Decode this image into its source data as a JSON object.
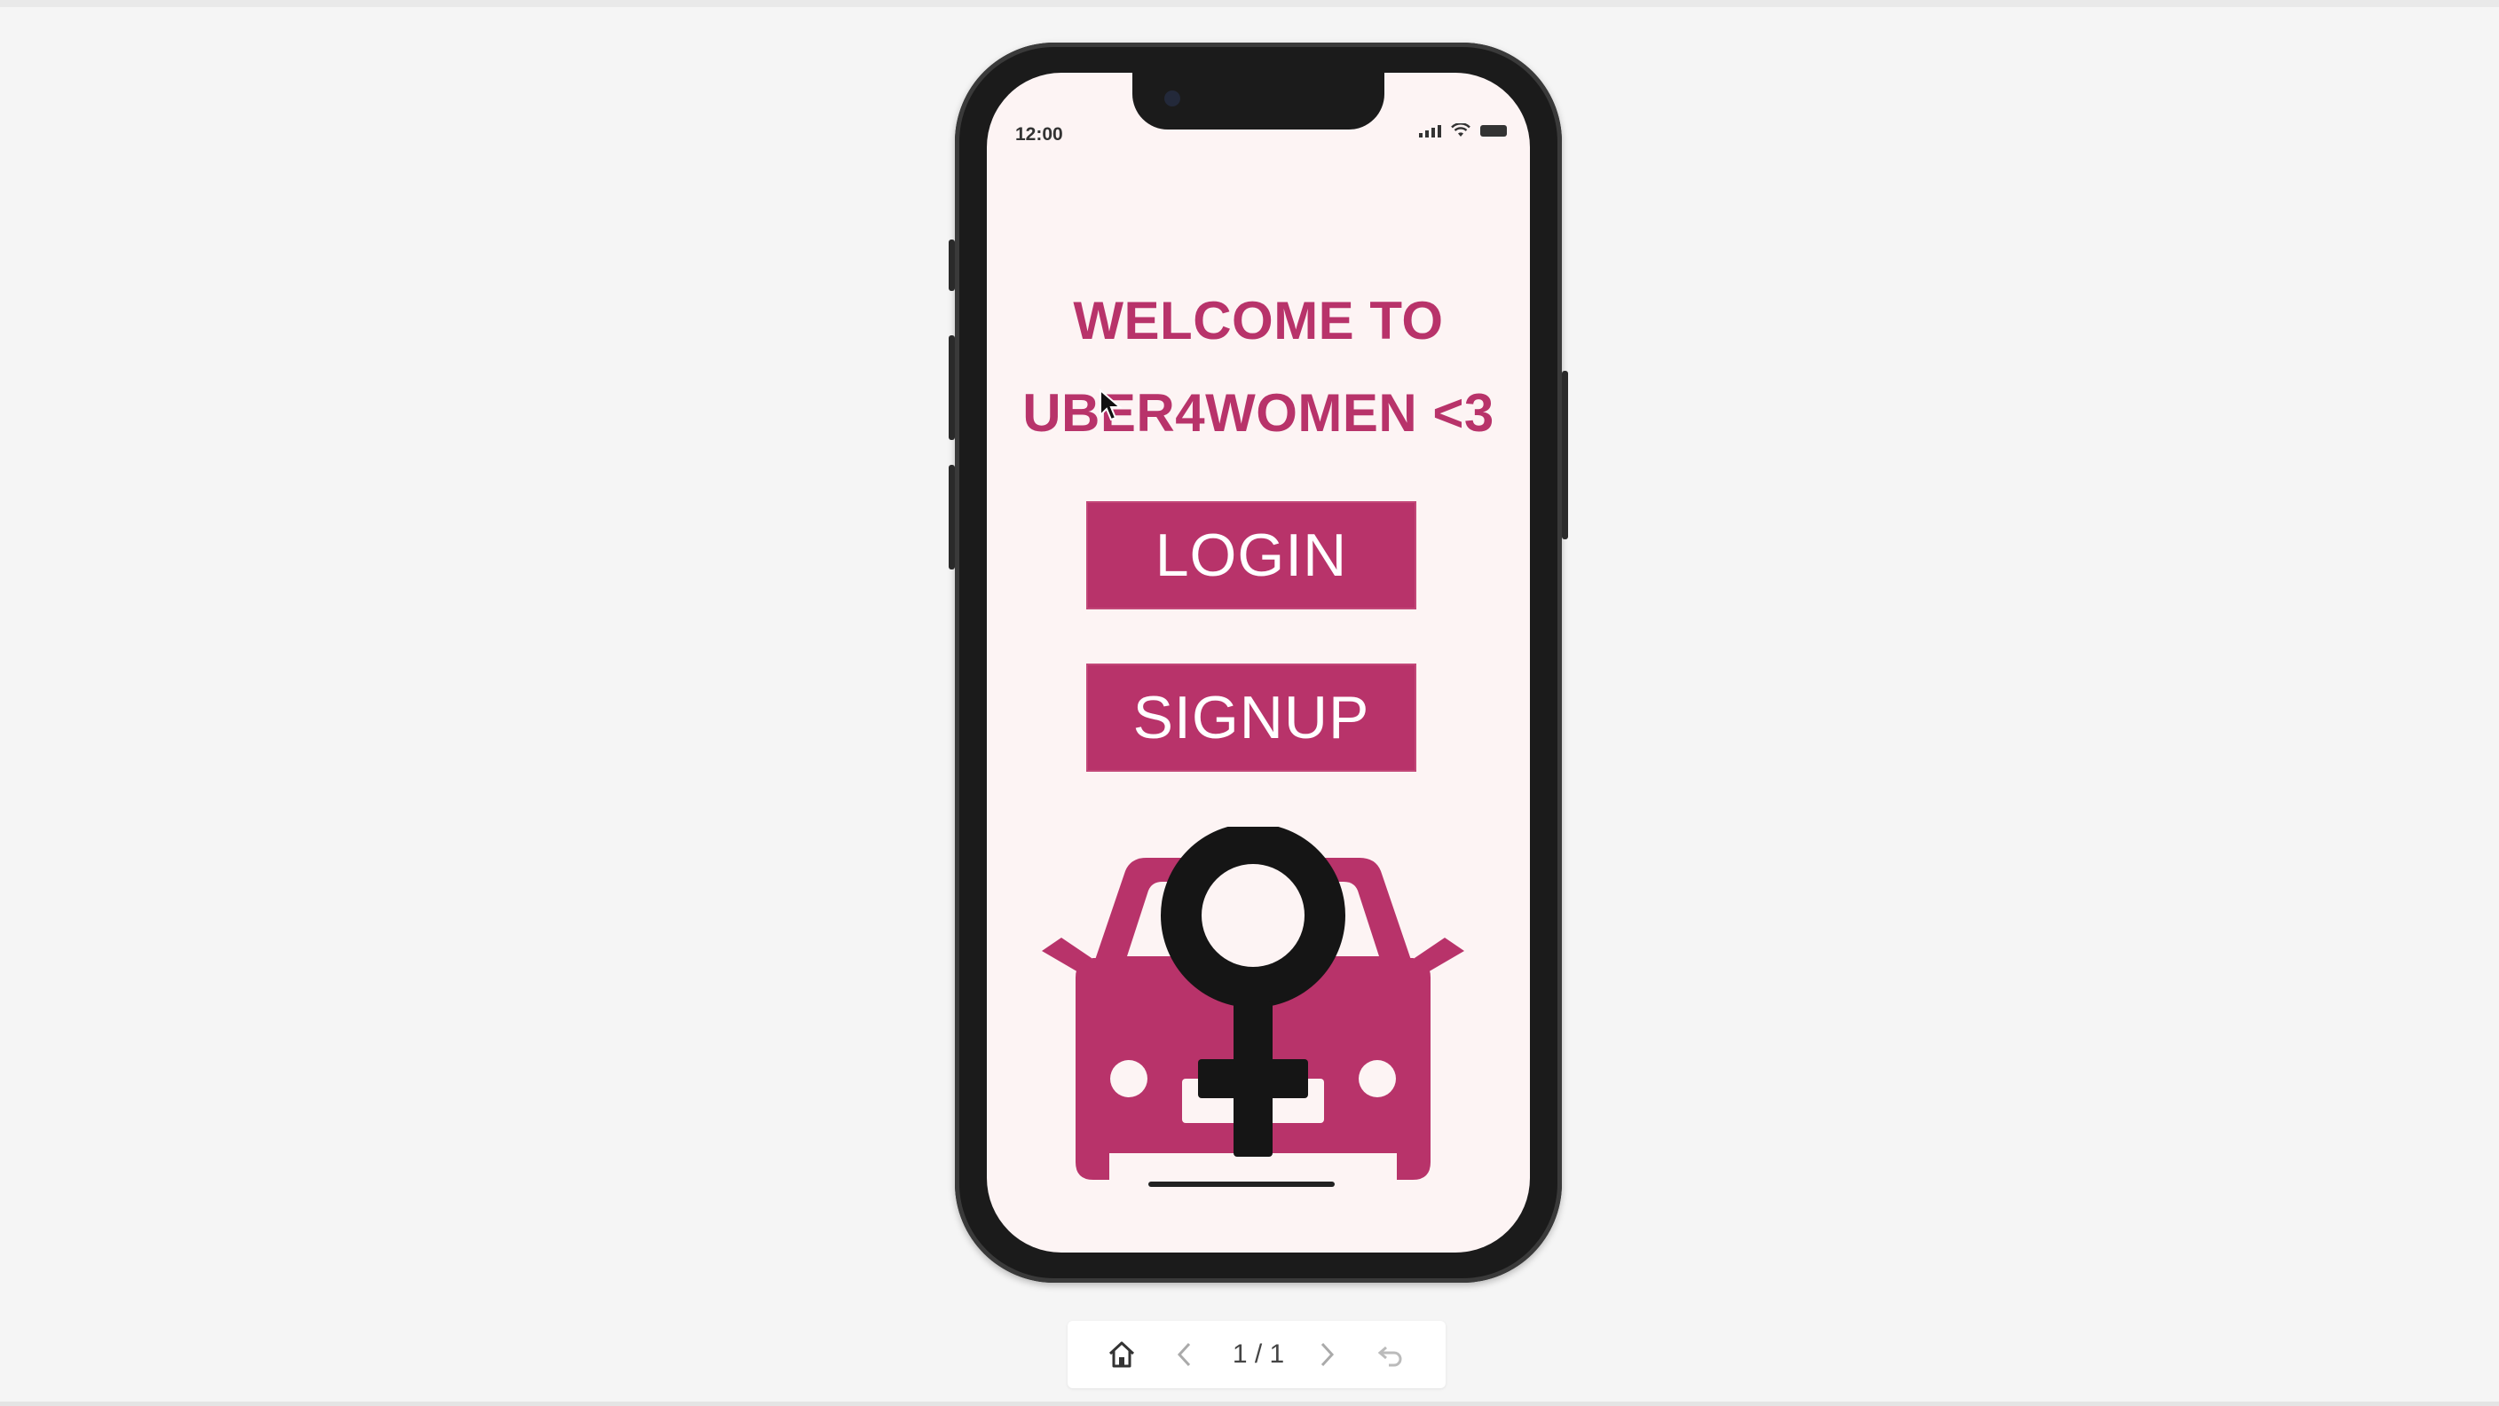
{
  "phone": {
    "status_bar": {
      "time": "12:00"
    },
    "welcome": {
      "line1": "WELCOME TO",
      "line2": "UBER4WOMEN <3"
    },
    "buttons": {
      "login": "LOGIN",
      "signup": "SIGNUP"
    },
    "logo": {
      "icon": "car-female-symbol-icon",
      "car_color": "#b8336a",
      "symbol_color": "#151515"
    }
  },
  "toolbar": {
    "page_indicator": "1 / 1",
    "icons": [
      "home-icon",
      "chevron-left-icon",
      "chevron-right-icon",
      "restart-icon"
    ]
  },
  "colors": {
    "accent": "#b8336a",
    "screen_bg": "#fdf4f4",
    "page_bg": "#f5f5f5"
  }
}
